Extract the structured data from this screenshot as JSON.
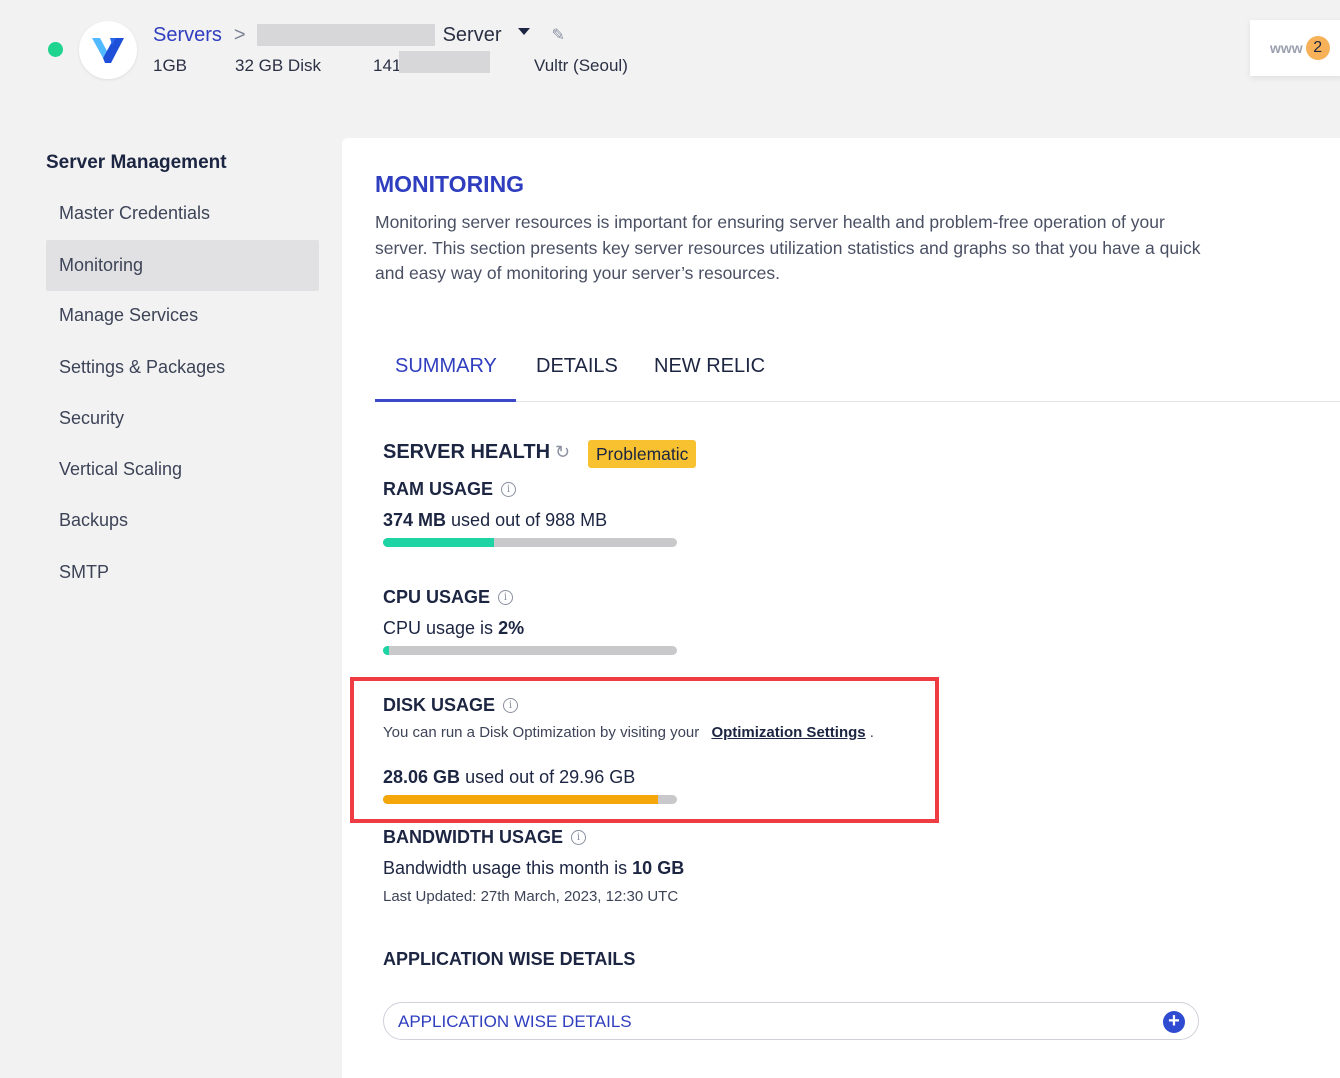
{
  "header": {
    "breadcrumb_root": "Servers",
    "breadcrumb_sep": ">",
    "server_name": "Server",
    "specs": {
      "ram": "1GB",
      "disk": "32 GB Disk",
      "ip_prefix": "141.",
      "provider": "Vultr (Seoul)"
    },
    "status_color": "#1ed48f",
    "www_label": "www",
    "www_count": "2"
  },
  "sidebar": {
    "title": "Server Management",
    "items": [
      {
        "label": "Master Credentials"
      },
      {
        "label": "Monitoring",
        "active": true
      },
      {
        "label": "Manage Services"
      },
      {
        "label": "Settings & Packages"
      },
      {
        "label": "Security"
      },
      {
        "label": "Vertical Scaling"
      },
      {
        "label": "Backups"
      },
      {
        "label": "SMTP"
      }
    ]
  },
  "main": {
    "title": "MONITORING",
    "intro": "Monitoring server resources is important for ensuring server health and problem-free operation of your server. This section presents key server resources utilization statistics and graphs so that you have a quick and easy way of monitoring your server’s resources.",
    "tabs": [
      {
        "label": "SUMMARY",
        "active": true
      },
      {
        "label": "DETAILS"
      },
      {
        "label": "NEW RELIC"
      }
    ],
    "health": {
      "title": "SERVER HEALTH",
      "status": "Problematic",
      "status_color": "#f8c12f"
    },
    "ram": {
      "title": "RAM USAGE",
      "used": "374 MB",
      "mid": "used out of",
      "total": "988 MB",
      "fill_fraction": 0.378,
      "color": "#1ed4a4"
    },
    "cpu": {
      "title": "CPU USAGE",
      "prefix": "CPU usage is",
      "value": "2%",
      "fill_fraction": 0.02,
      "color": "#1ed4a4"
    },
    "disk": {
      "title": "DISK USAGE",
      "note_prefix": "You can run a Disk Optimization by visiting your",
      "note_link": "Optimization Settings",
      "note_suffix": ".",
      "used": "28.06 GB",
      "mid": "used out of",
      "total": "29.96 GB",
      "fill_fraction": 0.937,
      "color": "#f5a60a"
    },
    "bandwidth": {
      "title": "BANDWIDTH USAGE",
      "prefix": "Bandwidth usage this month is",
      "value": "10 GB",
      "updated": "Last Updated: 27th March, 2023, 12:30 UTC"
    },
    "app_wise": {
      "title": "APPLICATION WISE DETAILS",
      "accordion_label": "APPLICATION WISE DETAILS",
      "plus": "+"
    }
  }
}
